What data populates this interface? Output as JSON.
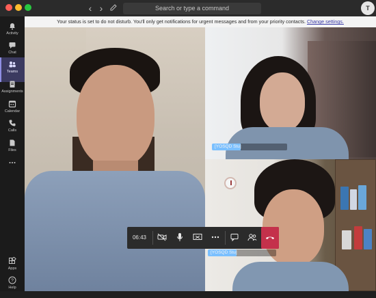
{
  "titlebar": {
    "search_placeholder": "Search or type a command",
    "avatar_initial": "T"
  },
  "sidebar": {
    "items": [
      {
        "label": "Activity",
        "icon": "bell-icon"
      },
      {
        "label": "Chat",
        "icon": "chat-icon"
      },
      {
        "label": "Teams",
        "icon": "teams-icon",
        "active": true
      },
      {
        "label": "Assignments",
        "icon": "assignments-icon"
      },
      {
        "label": "Calendar",
        "icon": "calendar-icon"
      },
      {
        "label": "Calls",
        "icon": "phone-icon"
      },
      {
        "label": "Files",
        "icon": "files-icon"
      },
      {
        "label": "",
        "icon": "more-icon"
      }
    ],
    "bottom": [
      {
        "label": "Apps",
        "icon": "apps-icon"
      },
      {
        "label": "Help",
        "icon": "help-icon"
      }
    ]
  },
  "notification": {
    "text": "Your status is set to do not disturb. You'll only get notifications for urgent messages and from your priority contacts.",
    "link": "Change settings."
  },
  "participants": {
    "top_right_name": "[YOSQD Stu]",
    "bottom_right_name": "[YOSQD Stu]"
  },
  "call_controls": {
    "timer": "06:43",
    "icons": [
      "camera-off-icon",
      "microphone-icon",
      "share-screen-icon",
      "more-options-icon",
      "chat-icon",
      "participants-icon",
      "hang-up-icon"
    ]
  },
  "colors": {
    "rail_bg": "#1b1b1b",
    "active_accent": "#8f8fe3",
    "hangup": "#c4314b",
    "notice_bg": "#f4f4f4"
  }
}
